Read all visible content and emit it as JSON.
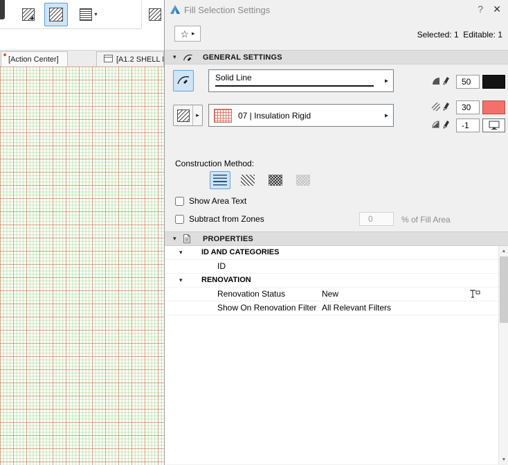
{
  "titlebar": {
    "title": "Fill Selection Settings",
    "help": "?",
    "close": "✕"
  },
  "icons": {
    "star": "☆",
    "arrow_right": "▸",
    "arrow_down": "▾",
    "scroll_up": "▲",
    "scroll_down": "▼"
  },
  "header": {
    "selected_info": "Selected: 1  Editable: 1"
  },
  "sections": {
    "general": "GENERAL SETTINGS",
    "properties": "PROPERTIES"
  },
  "general": {
    "line_type": "Solid Line",
    "fill_pattern": "07 | Insulation Rigid",
    "pens": [
      {
        "value": "50"
      },
      {
        "value": "30"
      },
      {
        "value": "-1"
      }
    ],
    "construction_label": "Construction Method:",
    "show_area_text": "Show Area Text",
    "subtract_from_zones": "Subtract from Zones",
    "fill_area_value": "0",
    "fill_area_suffix": "% of Fill Area"
  },
  "properties": {
    "group1": "ID AND CATEGORIES",
    "row_id": "ID",
    "group2": "RENOVATION",
    "renovation_status_label": "Renovation Status",
    "renovation_status_value": "New",
    "renovation_filter_label": "Show On Renovation Filter",
    "renovation_filter_value": "All Relevant Filters"
  },
  "tabs": [
    {
      "label": "[Action Center]"
    },
    {
      "label": "[A1.2 SHELL R"
    }
  ],
  "colors": {
    "selected_bg": "#cfe4f7",
    "selected_border": "#66a1d4",
    "fill_pen_swatch": "#141414",
    "background_pen_swatch": "#f3716b",
    "grid_minor": "#6ebe6e",
    "grid_major": "#e06e5a"
  }
}
